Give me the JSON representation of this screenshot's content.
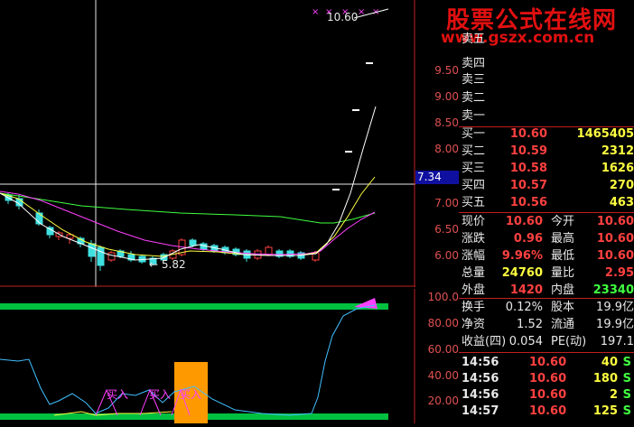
{
  "watermark": {
    "title": "股票公式在线网",
    "url": "www.gszx.com.cn"
  },
  "main_chart": {
    "top_annotation": "10.60",
    "low_annotation": "5.82",
    "crosshair_price": "7.34",
    "y_axis_labels": [
      "9.50",
      "9.00",
      "8.50",
      "8.00",
      "7.00",
      "6.50",
      "6.00"
    ],
    "colors": {
      "up": "#ff4040",
      "down": "#40e0e0",
      "ma5": "#ffffff",
      "ma10": "#ffff40",
      "ma20": "#ff40ff",
      "ma60": "#40ff40",
      "grid": "#c02020"
    }
  },
  "indicator_chart": {
    "y_axis_labels": [
      "100.0",
      "80.00",
      "60.00",
      "40.00",
      "20.00"
    ],
    "buy_labels": [
      "买入",
      "买入",
      "买入"
    ],
    "colors": {
      "line": "#40c0ff",
      "band": "#00c040",
      "signal": "#ff9900",
      "magenta": "#ff40ff"
    }
  },
  "quote": {
    "sell": [
      {
        "label": "卖五",
        "price": "",
        "vol": ""
      },
      {
        "label": "卖四",
        "price": "",
        "vol": ""
      },
      {
        "label": "卖三",
        "price": "",
        "vol": ""
      },
      {
        "label": "卖二",
        "price": "",
        "vol": ""
      },
      {
        "label": "卖一",
        "price": "",
        "vol": ""
      }
    ],
    "buy": [
      {
        "label": "买一",
        "price": "10.60",
        "vol": "1465405"
      },
      {
        "label": "买二",
        "price": "10.59",
        "vol": "2312"
      },
      {
        "label": "买三",
        "price": "10.58",
        "vol": "1626"
      },
      {
        "label": "买四",
        "price": "10.57",
        "vol": "270"
      },
      {
        "label": "买五",
        "price": "10.56",
        "vol": "463"
      }
    ],
    "stats": [
      {
        "l1": "现价",
        "v1": "10.60",
        "c1": "red",
        "l2": "今开",
        "v2": "10.60",
        "c2": "red"
      },
      {
        "l1": "涨跌",
        "v1": "0.96",
        "c1": "red",
        "l2": "最高",
        "v2": "10.60",
        "c2": "red"
      },
      {
        "l1": "涨幅",
        "v1": "9.96%",
        "c1": "red",
        "l2": "最低",
        "v2": "10.60",
        "c2": "red"
      },
      {
        "l1": "总量",
        "v1": "24760",
        "c1": "yellow",
        "l2": "量比",
        "v2": "2.95",
        "c2": "red"
      },
      {
        "l1": "外盘",
        "v1": "1420",
        "c1": "red",
        "l2": "内盘",
        "v2": "23340",
        "c2": "green"
      }
    ],
    "fundamentals": [
      {
        "l1": "换手",
        "v1": "0.12%",
        "l2": "股本",
        "v2": "19.9亿"
      },
      {
        "l1": "净资",
        "v1": "1.52",
        "l2": "流通",
        "v2": "19.9亿"
      },
      {
        "l1": "收益(四)",
        "v1": "0.054",
        "l2": "PE(动)",
        "v2": "197.1"
      }
    ],
    "ticks": [
      {
        "time": "14:56",
        "price": "10.60",
        "vol": "40",
        "side": "S"
      },
      {
        "time": "14:56",
        "price": "10.60",
        "vol": "180",
        "side": "S"
      },
      {
        "time": "14:56",
        "price": "10.60",
        "vol": "2",
        "side": "S"
      },
      {
        "time": "14:57",
        "price": "10.60",
        "vol": "125",
        "side": "S"
      }
    ]
  }
}
